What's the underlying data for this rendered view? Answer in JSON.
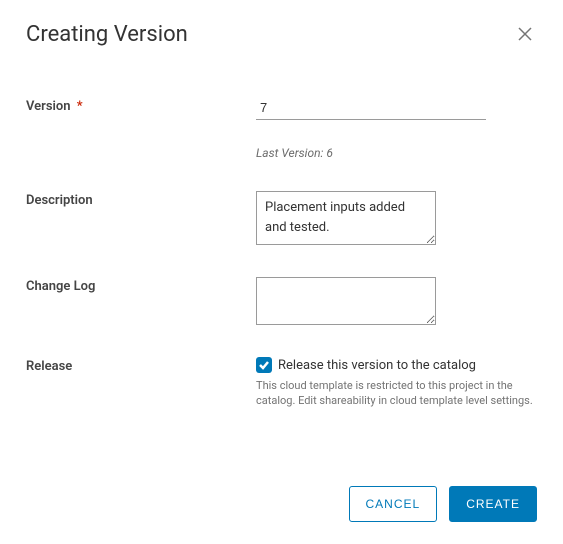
{
  "dialog": {
    "title": "Creating Version"
  },
  "fields": {
    "version": {
      "label": "Version",
      "value": "7",
      "required_marker": "*"
    },
    "last_version": "Last Version: 6",
    "description": {
      "label": "Description",
      "value": "Placement inputs added and tested."
    },
    "change_log": {
      "label": "Change Log",
      "value": ""
    },
    "release": {
      "label": "Release",
      "checkbox_label": "Release this version to the catalog",
      "checked": true,
      "note": "This cloud template is restricted to this project in the catalog. Edit shareability in cloud template level settings."
    }
  },
  "actions": {
    "cancel": "CANCEL",
    "create": "CREATE"
  }
}
